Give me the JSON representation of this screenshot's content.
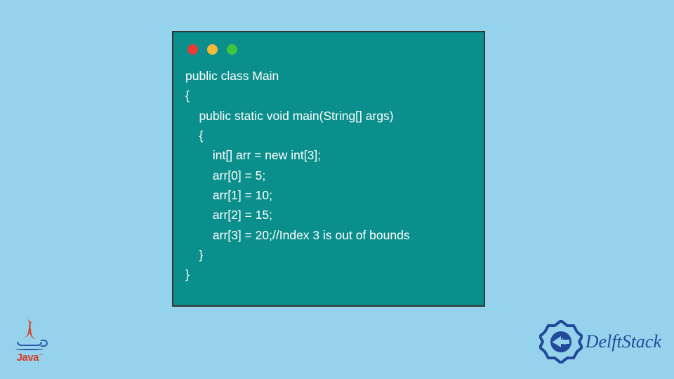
{
  "code": {
    "lines": [
      "public class Main",
      "{",
      "    public static void main(String[] args)",
      "    {",
      "        int[] arr = new int[3];",
      "        arr[0] = 5;",
      "        arr[1] = 10;",
      "        arr[2] = 15;",
      "        arr[3] = 20;//Index 3 is out of bounds",
      "    }",
      "}"
    ]
  },
  "logos": {
    "java_label": "Java",
    "java_tm": "™",
    "delft_label": "DelftStack"
  },
  "colors": {
    "page_bg": "#95d3ed",
    "window_bg": "#0b8f8c",
    "code_text": "#ffffff",
    "dot_red": "#e73d37",
    "dot_yellow": "#f6b93a",
    "dot_green": "#3ec63e",
    "java_red": "#d83a27",
    "java_blue": "#2b5aa3",
    "delft_blue": "#214b9a"
  }
}
